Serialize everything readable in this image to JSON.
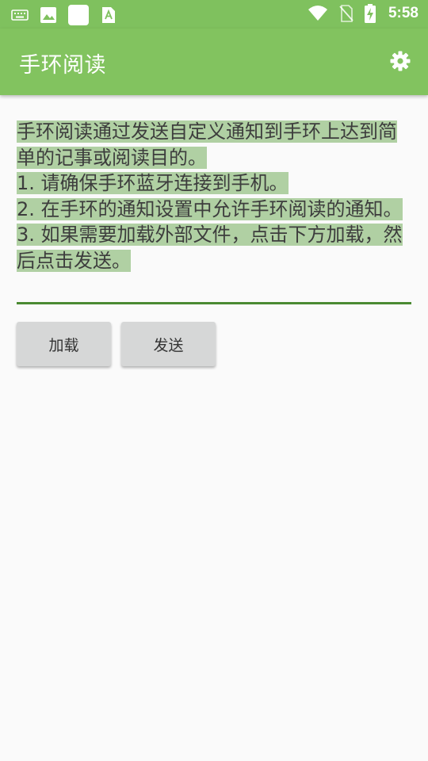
{
  "status_bar": {
    "time": "5:58",
    "left_icons": [
      "keyboard-icon",
      "image-icon",
      "blank-notification-icon",
      "accessibility-a-icon"
    ],
    "right_icons": [
      "wifi-icon",
      "no-sim-icon",
      "battery-charging-icon"
    ]
  },
  "app_bar": {
    "title": "手环阅读",
    "settings_icon": "gear-icon"
  },
  "editor": {
    "text": "手环阅读通过发送自定义通知到手环上达到简单的记事或阅读目的。\n1. 请确保手环蓝牙连接到手机。\n2. 在手环的通知设置中允许手环阅读的通知。\n3. 如果需要加载外部文件，点击下方加载，然后点击发送。"
  },
  "buttons": {
    "load_label": "加载",
    "send_label": "发送"
  },
  "colors": {
    "accent": "#82c35f",
    "status_bar": "#7fc15e",
    "selection": "#b0d0a3",
    "underline": "#4a8a32"
  }
}
